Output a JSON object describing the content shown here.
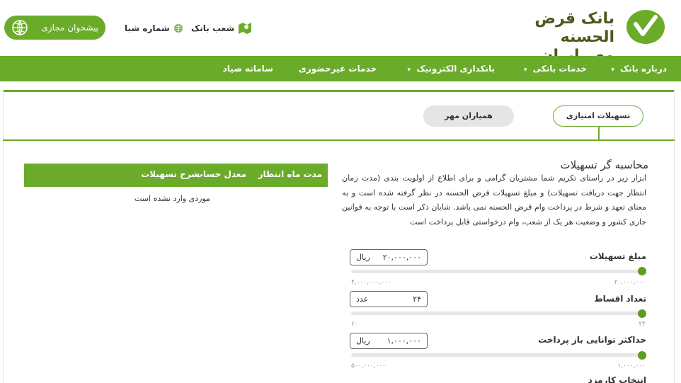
{
  "brand": {
    "line1": "بانک قرض الحسنه",
    "line2": "مهر ایران",
    "color": "#6aab2a"
  },
  "header": {
    "portal_label": "پیشخوان مجازی",
    "shaba_label": "شماره شبا",
    "branches_label": "شعب بانک"
  },
  "nav": {
    "items": [
      {
        "label": "درباره بانک",
        "dropdown": true
      },
      {
        "label": "خدمات بانکی",
        "dropdown": true
      },
      {
        "label": "بانکداری الکترونیک",
        "dropdown": true
      },
      {
        "label": "خدمات غیرحضوری",
        "dropdown": false
      },
      {
        "label": "سامانه صیاد",
        "dropdown": false
      }
    ],
    "caret": "▾"
  },
  "tabs": {
    "active": "تسهیلات امتیازی",
    "inactive": "همیاران مهر"
  },
  "calculator": {
    "title": "محاسبه گر تسهیلات",
    "description": "ابزار زیر در راستای تکریم شما مشتریان گرامی و برای اطلاع از اولویت بندی (مدت زمان انتظار جهت دریافت تسهیلات) و مبلغ تسهیلات قرض الحسنه در نظر گرفته شده است و به معنای تعهد و شرط در پرداخت وام قرض الحسنه نمی باشد. شایان ذکر است با توجه به قوانین جاری کشور و وضعیت هر یک از شعب، وام درخواستی قابل پرداخت است",
    "fields": [
      {
        "label": "مبلغ تسهیلات",
        "value": "۲۰,۰۰۰,۰۰۰",
        "unit": "ریال",
        "min": "۲۰,۰۰۰,۰۰۰",
        "max": "۴,۰۰۰,۰۰۰,۰۰۰"
      },
      {
        "label": "تعداد اقساط",
        "value": "۲۴",
        "unit": "عدد",
        "min": "۲۴",
        "max": "۶۰"
      },
      {
        "label": "حداکثر توانایی باز پرداخت",
        "value": "۱,۰۰۰,۰۰۰",
        "unit": "ریال",
        "min": "۱,۰۰۰,۰۰۰",
        "max": "۵۰۰,۰۰۰,۰۰۰"
      }
    ],
    "next_label": "انتخاب کارمزد"
  },
  "results": {
    "columns": [
      "مدت ماه انتظار",
      "معدل حساب",
      "شرح تسهیلات"
    ],
    "empty_message": "موردی وارد نشده است"
  }
}
